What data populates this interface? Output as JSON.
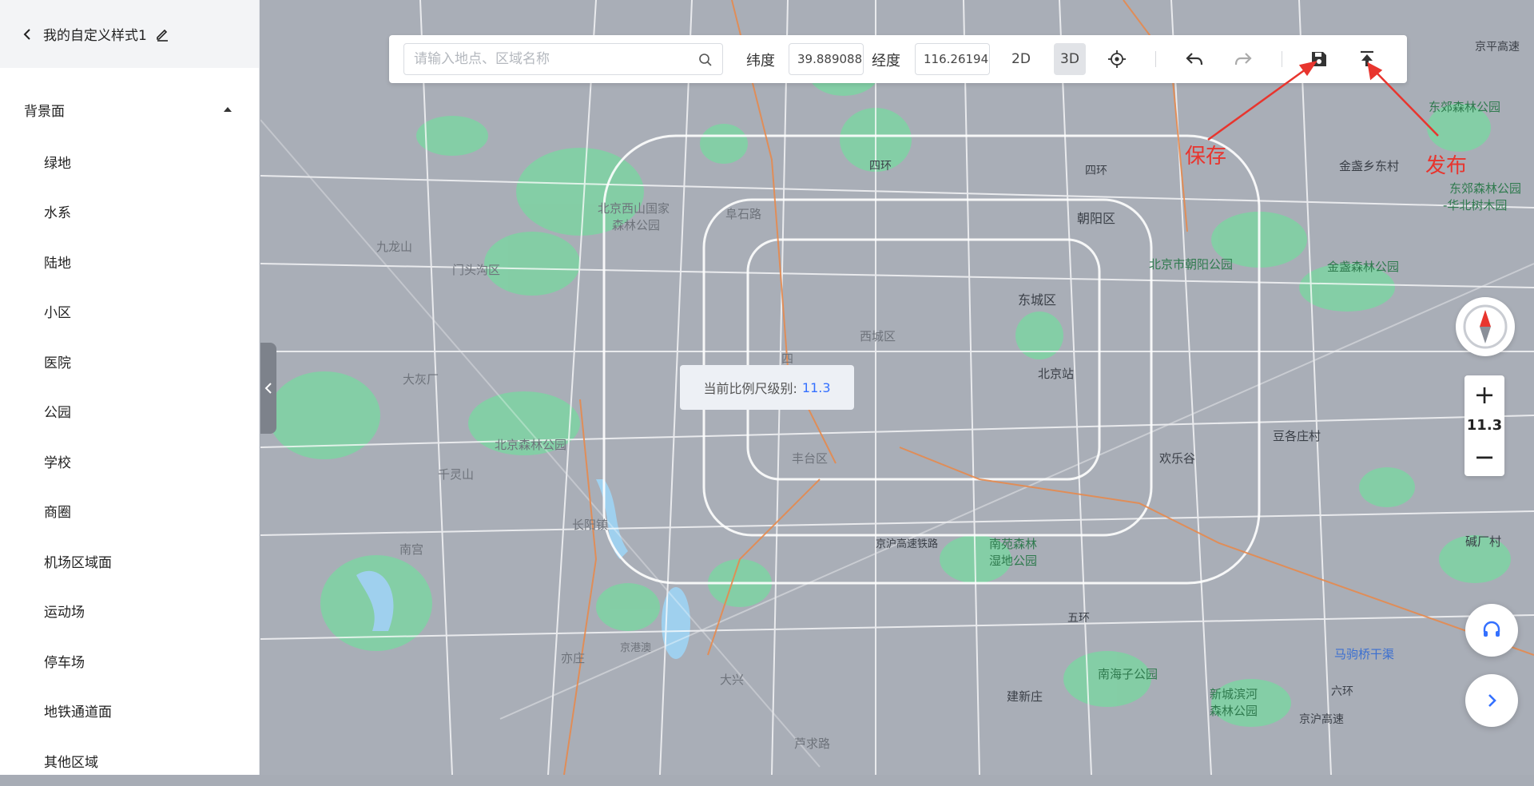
{
  "sidebar": {
    "title": "我的自定义样式1",
    "section_label": "背景面",
    "items": [
      "绿地",
      "水系",
      "陆地",
      "小区",
      "医院",
      "公园",
      "学校",
      "商圈",
      "机场区域面",
      "运动场",
      "停车场",
      "地铁通道面",
      "其他区域"
    ]
  },
  "toolbar": {
    "search_placeholder": "请输入地点、区域名称",
    "lat_label": "纬度",
    "lat_value": "39.889088",
    "lng_label": "经度",
    "lng_value": "116.26194",
    "mode_2d": "2D",
    "mode_3d": "3D",
    "active_mode": "3D"
  },
  "annotations": {
    "save": "保存",
    "publish": "发布"
  },
  "scale_tip": {
    "label": "当前比例尺级别:",
    "value": "11.3"
  },
  "zoom": {
    "level": "11.3",
    "plus": "+",
    "minus": "−"
  },
  "map_labels": {
    "chaoyang": "朝阳区",
    "dongcheng": "东城区",
    "beijing_station": "北京站",
    "xicheng": "西城区",
    "fengtai": "丰台区",
    "daxing_hint": "大兴",
    "huanlegu": "欢乐谷",
    "dougezhuang": "豆各庄村",
    "chaoyang_park": "北京市朝阳公园",
    "jinzhan_village": "金盏乡东村",
    "jinzhan_park": "金盏森林公园",
    "dongjiao_1": "东郊森林公园",
    "dongjiao_2": "东郊森林公园",
    "huabei": "-华北树木园",
    "nanyuan_1": "南苑森林",
    "nanyuan_2": "湿地公园",
    "nanhaizi": "南海子公园",
    "jianxin": "建新庄",
    "xinfeng_1": "新城滨河",
    "xinfeng_2": "森林公园",
    "majuqiao": "马驹桥干渠",
    "tuan": "碱厂村",
    "sihuan": "四环",
    "sihuan2": "四环",
    "wuhuan": "五环",
    "liuhuan": "六环",
    "jingping": "京平高速",
    "jinghu": "京沪高速",
    "jinghu_rail": "京沪高速铁路",
    "haidian_hint": "四",
    "xiangshan": "北京西山国家",
    "xiangshan2": "森林公园",
    "fushi": "阜石路",
    "menjgou": "门头沟区",
    "jiulong": "九龙山",
    "dahuishan": "大灰厂",
    "qianling": "千灵山",
    "nangong": "南宫",
    "changyang": "长阳镇",
    "yizhuang": "亦庄",
    "luyuan": "芦求路",
    "fangshan_hint": "京港澳",
    "beiqijia": "北京森林公园"
  },
  "colors": {
    "map_bg": "#a9aeb7",
    "green": "#7ed3a3",
    "water": "#9fd0ee",
    "road": "#ffffff",
    "rail": "#e58a4e",
    "accent": "#3470ff",
    "annotation": "#e8352e"
  },
  "icons": {
    "search": "search-icon",
    "locate": "locate-icon",
    "undo": "undo-icon",
    "redo": "redo-icon",
    "save": "save-icon",
    "publish": "upload-icon",
    "compass": "compass-icon",
    "support": "headset-icon",
    "expand": "chevron-right-icon",
    "back": "chevron-left-icon",
    "edit": "edit-icon"
  }
}
